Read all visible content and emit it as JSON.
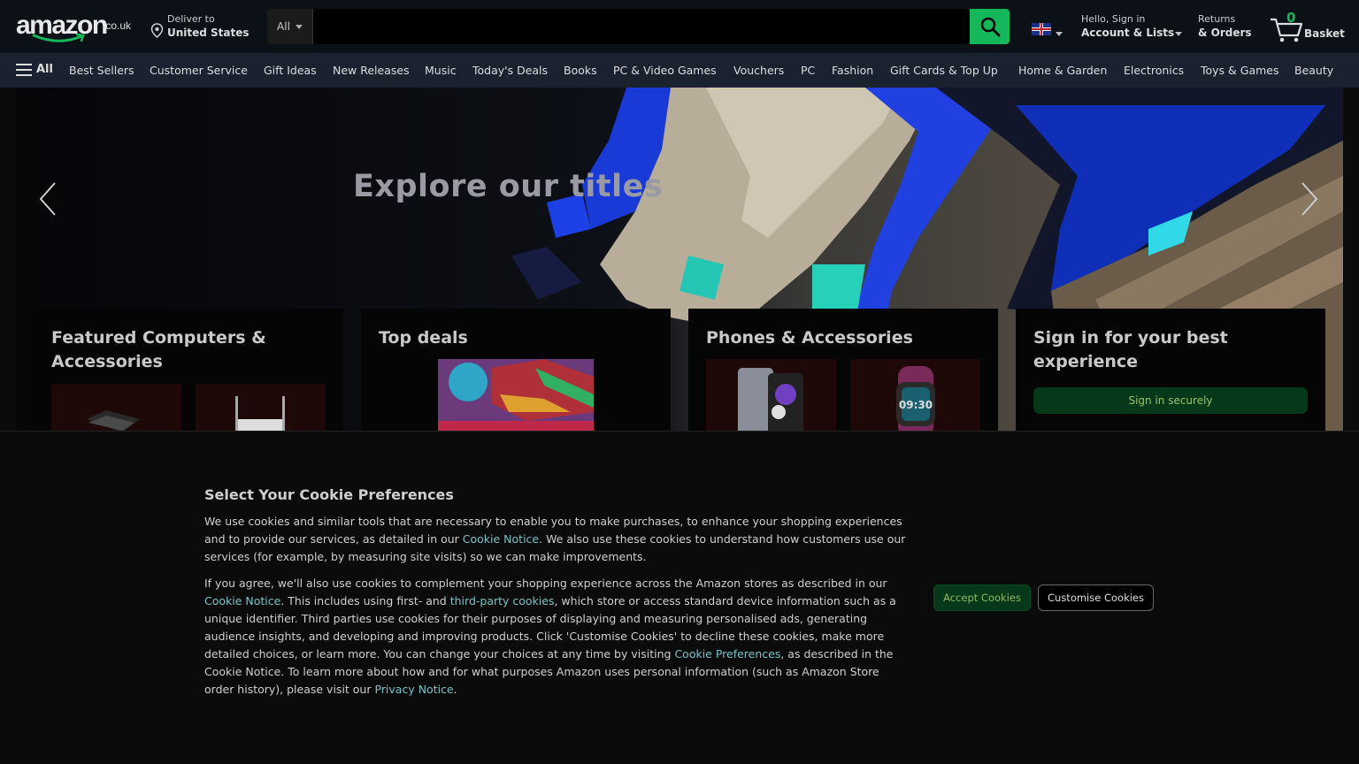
{
  "header": {
    "logo_text": "amazon",
    "logo_tld": ".co.uk",
    "deliver_line1": "Deliver to",
    "deliver_line2": "United States",
    "search_category": "All",
    "search_placeholder": "",
    "account_line1": "Hello, Sign in",
    "account_line2": "Account & Lists",
    "orders_line1": "Returns",
    "orders_line2": "& Orders",
    "basket_count": "0",
    "basket_label": "Basket",
    "icons": [
      "location-pin-icon",
      "chevron-down-icon",
      "search-icon",
      "uk-flag-icon",
      "basket-icon"
    ]
  },
  "subnav": {
    "all_label": "All",
    "items": [
      "Best Sellers",
      "Customer Service",
      "Gift Ideas",
      "New Releases",
      "Music",
      "Today's Deals",
      "Books",
      "PC & Video Games",
      "Vouchers",
      "PC",
      "Fashion",
      "Gift Cards & Top Up",
      "Home & Garden",
      "Electronics",
      "Toys & Games",
      "Beauty"
    ]
  },
  "hero": {
    "headline": "Explore our titles",
    "icons": [
      "carousel-prev-icon",
      "carousel-next-icon"
    ]
  },
  "cards": [
    {
      "title": "Featured Computers & Accessories"
    },
    {
      "title": "Top deals"
    },
    {
      "title": "Phones & Accessories"
    },
    {
      "title": "Sign in for your best experience",
      "button": "Sign in securely"
    }
  ],
  "cookie": {
    "title": "Select Your Cookie Preferences",
    "p1_a": "We use cookies and similar tools that are necessary to enable you to make purchases, to enhance your shopping experiences and to provide our services, as detailed in our ",
    "p1_link": "Cookie Notice",
    "p1_b": ". We also use these cookies to understand how customers use our services (for example, by measuring site visits) so we can make improvements.",
    "p2_a": "If you agree, we'll also use cookies to complement your shopping experience across the Amazon stores as described in our ",
    "p2_link1": "Cookie Notice",
    "p2_b": ". This includes using first- and ",
    "p2_link2": "third-party cookies",
    "p2_c": ", which store or access standard device information such as a unique identifier. Third parties use cookies for their purposes of displaying and measuring personalised ads, generating audience insights, and developing and improving products. Click 'Customise Cookies' to decline these cookies, make more detailed choices, or learn more. You can change your choices at any time by visiting ",
    "p2_link3": "Cookie Preferences",
    "p2_d": ", as described in the Cookie Notice. To learn more about how and for what purposes Amazon uses personal information (such as Amazon Store order history), please visit our ",
    "p2_link4": "Privacy Notice",
    "p2_e": ".",
    "accept_label": "Accept Cookies",
    "customise_label": "Customise Cookies"
  },
  "colors": {
    "header_bg": "#0c1118",
    "subnav_bg": "#1a2230",
    "search_button": "#14b85a",
    "link": "#77c2c7",
    "primary_button": "#05391a"
  }
}
